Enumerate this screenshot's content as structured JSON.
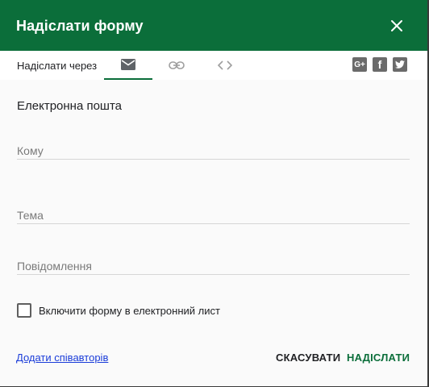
{
  "dialog": {
    "title": "Надіслати форму",
    "close_icon": "close-icon"
  },
  "tabs": {
    "via_label": "Надіслати через",
    "items": [
      {
        "icon": "envelope-icon",
        "active": true
      },
      {
        "icon": "link-icon",
        "active": false
      },
      {
        "icon": "code-icon",
        "active": false
      }
    ]
  },
  "social": {
    "gplus_label": "G+",
    "facebook_label": "f",
    "twitter_icon": "twitter-icon"
  },
  "email_form": {
    "section_title": "Електронна пошта",
    "to_placeholder": "Кому",
    "subject_placeholder": "Тема",
    "message_placeholder": "Повідомлення",
    "include_form_label": "Включити форму в електронний лист",
    "include_form_checked": false
  },
  "footer": {
    "add_collaborators": "Додати співавторів",
    "cancel": "СКАСУВАТИ",
    "send": "НАДІСЛАТИ"
  },
  "colors": {
    "brand": "#0b6e3a",
    "link": "#1a3cd9"
  }
}
